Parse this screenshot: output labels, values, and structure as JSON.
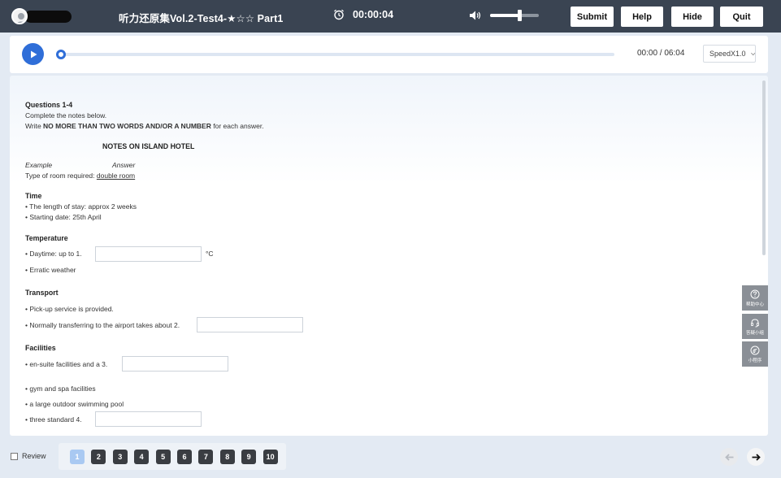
{
  "topbar": {
    "title": "听力还原集Vol.2-Test4-★☆☆ Part1",
    "timer": "00:00:04",
    "volume_level": 0.6,
    "buttons": {
      "submit": "Submit",
      "help": "Help",
      "hide": "Hide",
      "quit": "Quit"
    }
  },
  "audio": {
    "progress": 0.0,
    "time_readout": "00:00 / 06:04",
    "speed": "SpeedX1.0"
  },
  "content": {
    "questions_heading": "Questions 1-4",
    "instruction1": "Complete the notes below.",
    "instruction2_prefix": "Write ",
    "instruction2_bold": "NO MORE THAN TWO WORDS AND/OR A NUMBER",
    "instruction2_suffix": " for each answer.",
    "notes_title": "NOTES ON ISLAND HOTEL",
    "example_label": "Example",
    "answer_label": "Answer",
    "example_prefix": "Type of room required: ",
    "example_answer": "double room",
    "sections": {
      "time": {
        "heading": "Time",
        "line1": "• The length of stay: approx 2 weeks",
        "line2": "• Starting date: 25th April"
      },
      "temperature": {
        "heading": "Temperature",
        "q1_prefix": "• Daytime: up to 1.",
        "q1_unit": "°C",
        "line2": "• Erratic weather"
      },
      "transport": {
        "heading": "Transport",
        "line1": "• Pick-up service is provided.",
        "q2_prefix": "• Normally transferring to the airport takes about 2."
      },
      "facilities": {
        "heading": "Facilities",
        "q3_prefix": "• en-suite facilities and a 3.",
        "line2": "• gym and spa facilities",
        "line3": "• a large outdoor swimming pool",
        "q4_prefix": "• three standard 4."
      }
    }
  },
  "side_widgets": {
    "help_center": "帮助中心",
    "assistant": "答疑小组",
    "mini_program": "小程序"
  },
  "bottom": {
    "review_label": "Review",
    "questions": [
      "1",
      "2",
      "3",
      "4",
      "5",
      "6",
      "7",
      "8",
      "9",
      "10"
    ],
    "active_question": "1"
  }
}
